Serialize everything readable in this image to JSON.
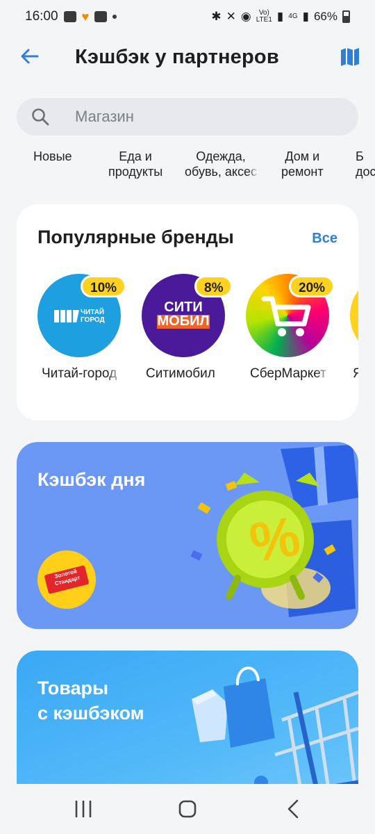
{
  "status_bar": {
    "time": "16:00",
    "dot": "•",
    "volte": "Vo)\nLTE1",
    "network": "4G",
    "battery": "66%"
  },
  "header": {
    "title": "Кэшбэк у партнеров",
    "back_icon": "arrow-left-icon",
    "map_icon": "map-icon"
  },
  "search": {
    "placeholder": "Магазин",
    "value": ""
  },
  "categories": [
    {
      "label": "Новые"
    },
    {
      "label": "Еда и\nпродукты"
    },
    {
      "label": "Одежда,\nобувь, аксес"
    },
    {
      "label": "Дом и\nремонт"
    },
    {
      "label": "Б\nдос"
    }
  ],
  "brands": {
    "title": "Популярные бренды",
    "all_label": "Все",
    "items": [
      {
        "name": "Читай-город",
        "cashback": "10%",
        "logo_text": "ЧИТАЙ\nГОРОД",
        "color": "#1ea0e0"
      },
      {
        "name": "Ситимобил",
        "cashback": "8%",
        "logo_text": "СИТИ\nМОБИЛ",
        "color": "#4a1a9a"
      },
      {
        "name": "СберМаркет",
        "cashback": "20%",
        "logo_text": "",
        "color": "#21b04b"
      },
      {
        "name": "Я",
        "cashback": "",
        "logo_text": "",
        "color": "#ffd21f"
      }
    ]
  },
  "promo_day": {
    "title": "Кэшбэк дня",
    "partner_logo_text": "Золотой\nСтандарт"
  },
  "promo_goods": {
    "title": "Товары\nс кэшбэком"
  },
  "colors": {
    "accent": "#2f7fd6",
    "badge": "#ffd21f",
    "promo_day_bg": "#6a98f4",
    "promo_goods_bg": "#3aa8f6"
  },
  "nav": {
    "recents_icon": "recents-icon",
    "home_icon": "home-icon",
    "back_icon": "back-icon"
  }
}
